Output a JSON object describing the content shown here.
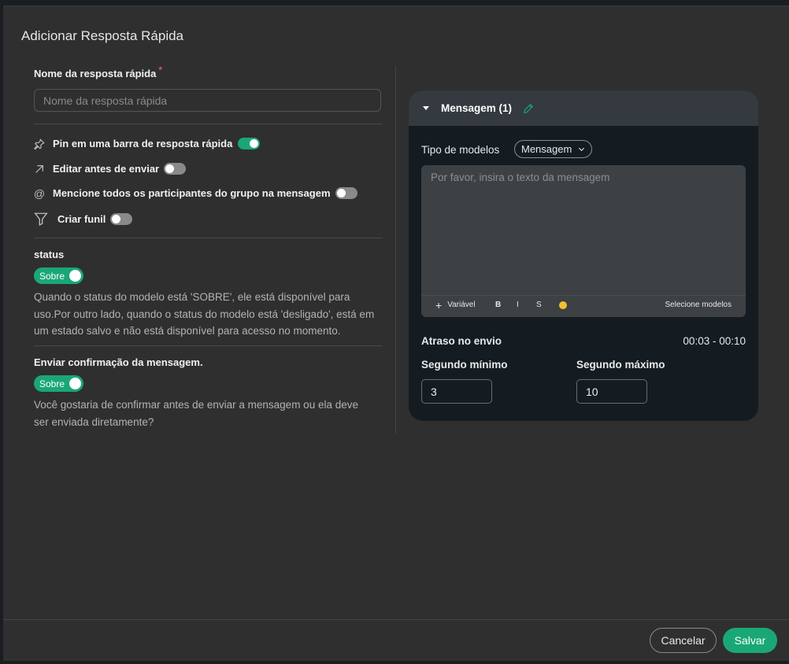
{
  "dialog": {
    "title": "Adicionar Resposta Rápida"
  },
  "name_field": {
    "label": "Nome da resposta rápida",
    "required_mark": "*",
    "placeholder": "Nome da resposta rápida",
    "value": ""
  },
  "options": [
    {
      "label": "Pin em uma barra de resposta rápida",
      "icon": "pin-icon",
      "enabled": true
    },
    {
      "label": "Editar antes de enviar",
      "icon": "arrow-up-right-icon",
      "enabled": false
    },
    {
      "label": "Mencione todos os participantes do grupo na mensagem",
      "icon": "at-icon",
      "enabled": false
    },
    {
      "label": "Criar funil",
      "icon": "funnel-icon",
      "enabled": false
    }
  ],
  "status": {
    "label": "status",
    "toggle_text": "Sobre",
    "enabled": true,
    "description": "Quando o status do modelo está 'SOBRE', ele está disponível para uso.Por outro lado, quando o status do modelo está 'desligado', está em um estado salvo e não está disponível para acesso no momento."
  },
  "confirmation": {
    "label": "Enviar confirmação da mensagem.",
    "toggle_text": "Sobre",
    "enabled": true,
    "description": "Você gostaria de confirmar antes de enviar a mensagem ou ela deve ser enviada diretamente?"
  },
  "message_card": {
    "title": "Mensagem (1)",
    "type_label": "Tipo de modelos",
    "type_value": "Mensagem",
    "message_placeholder": "Por favor, insira o texto da mensagem",
    "toolbar": {
      "variable_label": "Variável",
      "bold_label": "B",
      "italic_label": "I",
      "strike_label": "S",
      "select_models_label": "Selecione modelos"
    },
    "delay_label": "Atraso no envio",
    "delay_range": "00:03 - 00:10",
    "min_label": "Segundo mínimo",
    "min_value": "3",
    "max_label": "Segundo máximo",
    "max_value": "10"
  },
  "footer": {
    "cancel_label": "Cancelar",
    "save_label": "Salvar"
  },
  "colors": {
    "accent": "#1aa776",
    "background": "#2f2f2f",
    "card": "#141c22"
  }
}
